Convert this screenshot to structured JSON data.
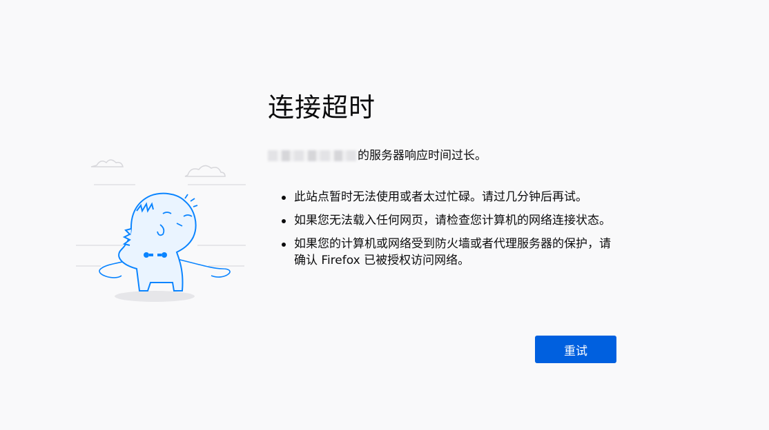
{
  "error": {
    "title": "连接超时",
    "description_suffix": "的服务器响应时间过长。",
    "reasons": [
      "此站点暂时无法使用或者太过忙碌。请过几分钟后再试。",
      "如果您无法载入任何网页，请检查您计算机的网络连接状态。",
      "如果您的计算机或网络受到防火墙或者代理服务器的保护，请确认 Firefox 已被授权访问网络。"
    ],
    "retry_label": "重试"
  },
  "illustration": {
    "icon": "unplugged-dinosaur-illustration"
  },
  "colors": {
    "background": "#f9f9fa",
    "accent": "#0060df",
    "illustration": "#0a84ff"
  }
}
